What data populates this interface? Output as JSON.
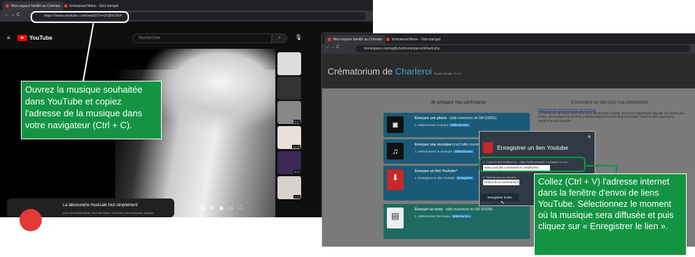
{
  "left_screen": {
    "tabs": [
      "Mon espace famille au Crémato",
      "Emmanuel Moire - Sois tranquil"
    ],
    "url": "https://www.youtube.com/watch?v=3VjBhSN4",
    "youtube_logo": "YouTube",
    "search_placeholder": "Rechercher",
    "card_title": "La découverte musicale tout simplement",
    "card_sub": "Avec la fonction Radio YouTube Music, découvrez des morceaux adaptés",
    "thumb_badges": [
      "5:27",
      "11:25",
      "6:41",
      "2:47"
    ]
  },
  "callout_left": "Ouvrez la musique souhaitée dans YouTube et copiez l'adresse de la musique dans votre navigateur (Ctrl + C).",
  "right_screen": {
    "tabs": [
      "Mon espace famille au Crémato",
      "Emmanuel Moire - Sois tranquil"
    ],
    "url": "monespace.cremagify.be/monespace/default.php",
    "site_title": "Crématorium de",
    "site_title_city": "Charleroi",
    "site_sub": "Espace famille V1.1.5",
    "col1_header": "Je prépare ma cérémonie",
    "col2_header": "Comment se déroule ma cérémonie",
    "links_title": "Espace famille du Crématorium de Charleroi",
    "links_body": "La Cérémonie de Potest TEST aura lieu le 08-04-2023 à 11h00. Vous avez l'opportunité d'ajouter des textes, des photos, des musiques et des liens youtube jusqu'au moment de la cérémonie. Passé ce délai, plus aucun transfert ne sera possible.",
    "blocks": [
      {
        "icon": "camera-icon",
        "title": "Envoyez une photo",
        "title_rest": " - taille maximum de 5M (5000k)",
        "line": "1. Sélectionnez la photo",
        "button": "Sélectionnez"
      },
      {
        "icon": "music-icon",
        "title": "Envoyez une musique",
        "title_rest": " (mp3 taille maximum 10M)",
        "line": "1. Sélectionnez la musique",
        "button": "Sélectionnez"
      },
      {
        "icon": "youtube-icon",
        "title": "Envoyez un lien Youtube",
        "title_rest": "*",
        "line": "1. Enregistrer le lien Youtube",
        "button": "Enregistrer"
      },
      {
        "icon": "document-icon",
        "title": "Envoyer un texte",
        "title_rest": " - taille maximum de 5M (5000k)",
        "line": "1. Sélectionnez les textes",
        "button": "Sélectionnez"
      }
    ],
    "modal": {
      "title": "Enregistrer un lien Youtube",
      "close": "×",
      "step1": "1. Collez le lien Youtube ex. : https://www.youtube.com/watch?v=xxx",
      "input_value": "www.youtube.com/watch?v=3VjBhSN4",
      "step2": "2. Sélectionnez le moment",
      "select_value": "Début de la cérémonie",
      "save": "Enregistrer le lien"
    }
  },
  "callout_right": "Collez (Ctrl + V) l'adresse internet dans la fenêtre d'envoi de liens YouTube. Sélectionnez le moment où la musique sera diffusée et puis cliquez sur « Enregistrer le lien »."
}
